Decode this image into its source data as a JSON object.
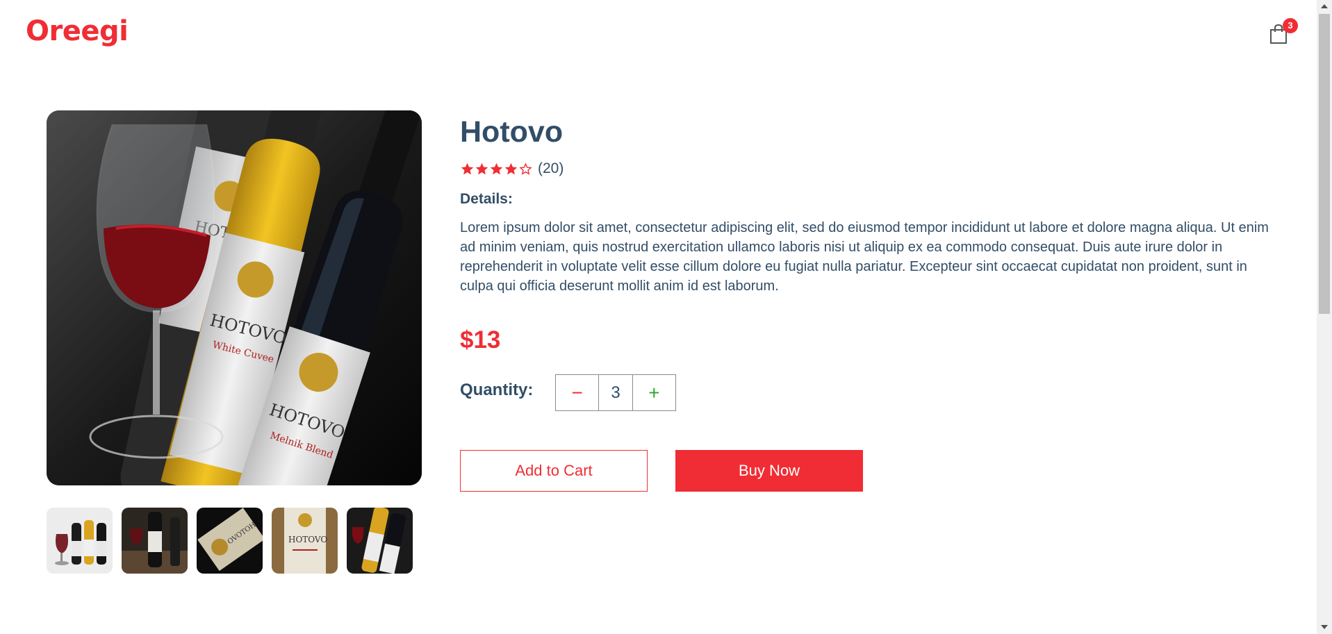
{
  "navbar": {
    "logo": "Oreegi",
    "cart_count": "3"
  },
  "product": {
    "name": "Hotovo",
    "rating_stars": 4,
    "rating_max": 5,
    "review_count": "(20)",
    "details_heading": "Details:",
    "description": "Lorem ipsum dolor sit amet, consectetur adipiscing elit, sed do eiusmod tempor incididunt ut labore et dolore magna aliqua. Ut enim ad minim veniam, quis nostrud exercitation ullamco laboris nisi ut aliquip ex ea commodo consequat. Duis aute irure dolor in reprehenderit in voluptate velit esse cillum dolore eu fugiat nulla pariatur. Excepteur sint occaecat cupidatat non proident, sunt in culpa qui officia deserunt mollit anim id est laborum.",
    "price": "$13",
    "quantity_label": "Quantity:",
    "quantity": "3"
  },
  "buttons": {
    "minus": "−",
    "plus": "+",
    "add_to_cart": "Add to Cart",
    "buy_now": "Buy Now"
  },
  "icons": {
    "cart": "shopping-bag-icon",
    "star_filled": "star-filled-icon",
    "star_empty": "star-outline-icon"
  },
  "colors": {
    "accent": "#f02d34",
    "text": "#324d67",
    "plus": "#31a831"
  }
}
